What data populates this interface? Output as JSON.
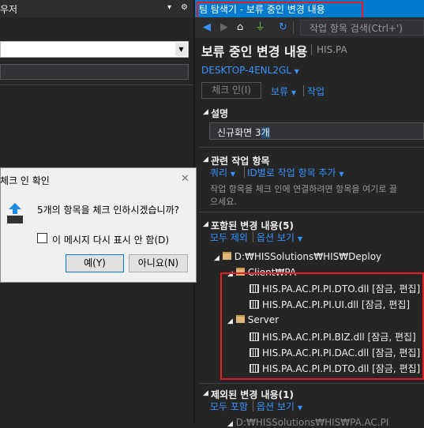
{
  "left_panel": {
    "title": "우저",
    "pin": "▾",
    "gear": "⚙"
  },
  "window": {
    "title": "팀 탐색기 - 보류 중인 변경 내용",
    "search_placeholder": "작업 항목 검색(Ctrl+')"
  },
  "page": {
    "title": "보류 중인 변경 내용",
    "subtitle": "HIS.PA",
    "connection": "DESKTOP-4ENL2GL",
    "checkin_button": "체크 인(I)",
    "hold_link": "보류",
    "work_link": "작업"
  },
  "description": {
    "header": "설명",
    "value_prefix": "신규화면 3",
    "value_selected": "개"
  },
  "related": {
    "header": "관련 작업 항목",
    "query_link": "쿼리",
    "add_by_id_link": "ID별로 작업 항목 추가",
    "help_line1": "작업 항목을 체크 인에 연결하려면 항목을 여기로 끌",
    "help_line2": "으세요."
  },
  "included": {
    "header": "포함된 변경 내용(5)",
    "exclude_all": "모두 제외",
    "view_options": "옵션 보기",
    "root_path": "D:₩HISSolutions₩HIS₩Deploy",
    "client_folder": "Client₩PA",
    "server_folder": "Server",
    "client_files": [
      "HIS.PA.AC.PI.PI.DTO.dll [잠금, 편집]",
      "HIS.PA.AC.PI.PI.UI.dll [잠금, 편집]"
    ],
    "server_files": [
      "HIS.PA.AC.PI.PI.BIZ.dll [잠금, 편집]",
      "HIS.PA.AC.PI.PI.DAC.dll [잠금, 편집]",
      "HIS.PA.AC.PI.PI.DTO.dll [잠금, 편집]"
    ]
  },
  "excluded": {
    "header": "제외된 변경 내용(1)",
    "include_all": "모두 포함",
    "view_options": "옵션 보기",
    "partial_path": "D:₩HISSolutions₩HIS₩PA.AC.PI"
  },
  "dialog": {
    "title": "체크 인 확인",
    "message": "5개의 항목을 체크 인하시겠습니까?",
    "dont_show": "이 메시지 다시 표시 안 함(D)",
    "yes": "예(Y)",
    "no": "아니요(N)",
    "close": "✕"
  },
  "colors": {
    "accent": "#007acc",
    "link": "#3794ff",
    "highlight": "#e51c23"
  }
}
